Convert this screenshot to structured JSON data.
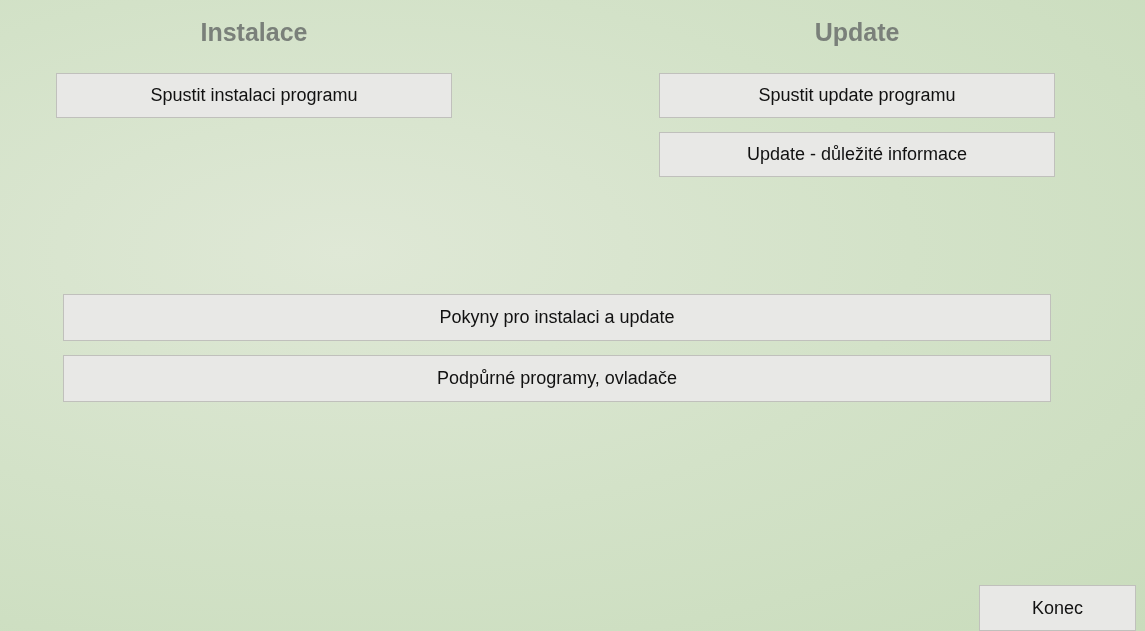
{
  "columns": [
    {
      "title": "Instalace",
      "buttons": [
        "Spustit instalaci programu"
      ]
    },
    {
      "title": "Update",
      "buttons": [
        "Spustit update programu",
        "Update - důležité informace"
      ]
    }
  ],
  "wide_buttons": [
    "Pokyny pro instalaci a update",
    "Podpůrné programy, ovladače"
  ],
  "exit_button": "Konec"
}
